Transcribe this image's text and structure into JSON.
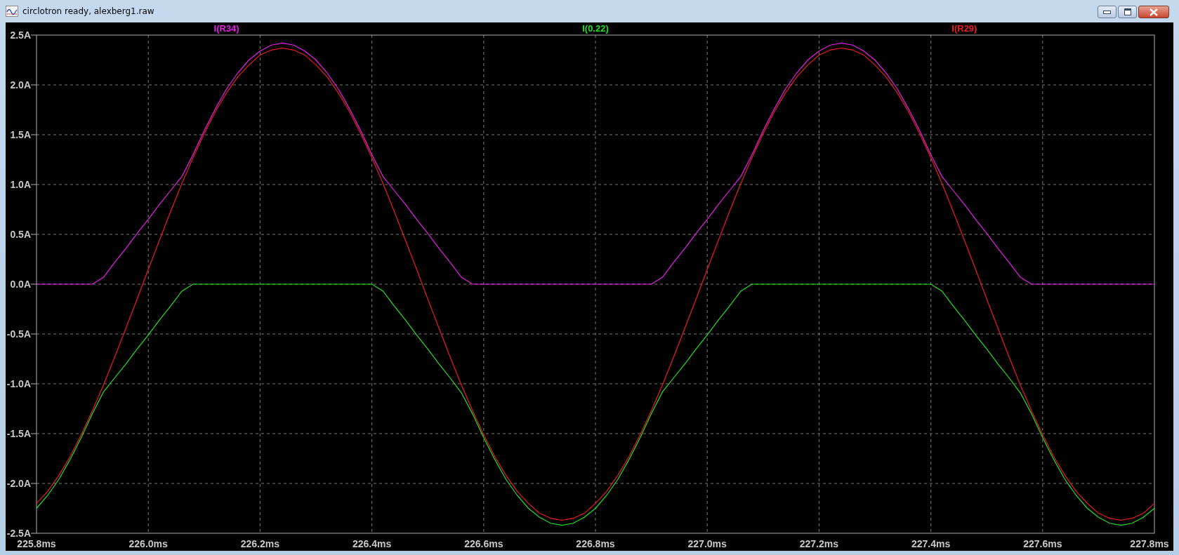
{
  "window": {
    "title": "circlotron ready, alexberg1.raw"
  },
  "plot": {
    "chart_data": {
      "type": "line",
      "x": [
        225.8,
        225.82,
        225.84,
        225.86,
        225.88,
        225.9,
        225.92,
        225.94,
        225.96,
        225.98,
        226,
        226.02,
        226.04,
        226.06,
        226.08,
        226.1,
        226.12,
        226.14,
        226.16,
        226.18,
        226.2,
        226.22,
        226.24,
        226.26,
        226.28,
        226.3,
        226.32,
        226.34,
        226.36,
        226.38,
        226.4,
        226.42,
        226.44,
        226.46,
        226.48,
        226.5,
        226.52,
        226.54,
        226.56,
        226.58,
        226.6,
        226.62,
        226.64,
        226.66,
        226.68,
        226.7,
        226.72,
        226.74,
        226.76,
        226.78,
        226.8,
        226.82,
        226.84,
        226.86,
        226.88,
        226.9,
        226.92,
        226.94,
        226.96,
        226.98,
        227,
        227.02,
        227.04,
        227.06,
        227.08,
        227.1,
        227.12,
        227.14,
        227.16,
        227.18,
        227.2,
        227.22,
        227.24,
        227.26,
        227.28,
        227.3,
        227.32,
        227.34,
        227.36,
        227.38,
        227.4,
        227.42,
        227.44,
        227.46,
        227.48,
        227.5,
        227.52,
        227.54,
        227.56,
        227.58,
        227.6,
        227.62,
        227.64,
        227.66,
        227.68,
        227.7,
        227.72,
        227.74,
        227.76,
        227.78,
        227.8
      ],
      "series": [
        {
          "name": "I(R34)",
          "color": "#e81ee8",
          "values": [
            0,
            0,
            0,
            0,
            0,
            0,
            0.07,
            0.22,
            0.36,
            0.51,
            0.65,
            0.8,
            0.94,
            1.08,
            1.3,
            1.54,
            1.76,
            1.96,
            2.12,
            2.25,
            2.34,
            2.4,
            2.42,
            2.4,
            2.34,
            2.25,
            2.12,
            1.96,
            1.76,
            1.54,
            1.3,
            1.08,
            0.94,
            0.8,
            0.65,
            0.51,
            0.36,
            0.22,
            0.07,
            0,
            0,
            0,
            0,
            0,
            0,
            0,
            0,
            0,
            0,
            0,
            0,
            0,
            0,
            0,
            0,
            0,
            0.07,
            0.22,
            0.36,
            0.51,
            0.65,
            0.8,
            0.94,
            1.08,
            1.3,
            1.54,
            1.76,
            1.96,
            2.12,
            2.25,
            2.34,
            2.4,
            2.42,
            2.4,
            2.34,
            2.25,
            2.12,
            1.96,
            1.76,
            1.54,
            1.3,
            1.08,
            0.94,
            0.8,
            0.65,
            0.51,
            0.36,
            0.22,
            0.07,
            0,
            0,
            0,
            0,
            0,
            0,
            0,
            0,
            0,
            0,
            0,
            0
          ]
        },
        {
          "name": "I(0.22)",
          "color": "#22e022",
          "values": [
            -2.25,
            -2.12,
            -1.96,
            -1.76,
            -1.54,
            -1.3,
            -1.08,
            -0.94,
            -0.8,
            -0.65,
            -0.51,
            -0.36,
            -0.22,
            -0.07,
            0,
            0,
            0,
            0,
            0,
            0,
            0,
            0,
            0,
            0,
            0,
            0,
            0,
            0,
            0,
            0,
            0,
            -0.07,
            -0.22,
            -0.36,
            -0.51,
            -0.65,
            -0.8,
            -0.94,
            -1.09,
            -1.3,
            -1.54,
            -1.76,
            -1.96,
            -2.12,
            -2.25,
            -2.34,
            -2.4,
            -2.42,
            -2.4,
            -2.34,
            -2.25,
            -2.12,
            -1.96,
            -1.76,
            -1.54,
            -1.3,
            -1.08,
            -0.94,
            -0.8,
            -0.65,
            -0.51,
            -0.36,
            -0.22,
            -0.07,
            0,
            0,
            0,
            0,
            0,
            0,
            0,
            0,
            0,
            0,
            0,
            0,
            0,
            0,
            0,
            0,
            0,
            -0.07,
            -0.22,
            -0.36,
            -0.51,
            -0.65,
            -0.8,
            -0.94,
            -1.09,
            -1.3,
            -1.54,
            -1.76,
            -1.96,
            -2.12,
            -2.25,
            -2.34,
            -2.4,
            -2.42,
            -2.4,
            -2.34,
            -2.25
          ]
        },
        {
          "name": "I(R29)",
          "color": "#ee1c1c",
          "values": [
            -2.2,
            -2.08,
            -1.92,
            -1.73,
            -1.51,
            -1.27,
            -1.01,
            -0.73,
            -0.44,
            -0.15,
            0.15,
            0.44,
            0.73,
            1.01,
            1.27,
            1.51,
            1.73,
            1.92,
            2.08,
            2.2,
            2.3,
            2.35,
            2.37,
            2.35,
            2.3,
            2.2,
            2.08,
            1.92,
            1.73,
            1.51,
            1.27,
            1.01,
            0.73,
            0.44,
            0.15,
            -0.15,
            -0.44,
            -0.73,
            -1.01,
            -1.27,
            -1.51,
            -1.73,
            -1.92,
            -2.08,
            -2.2,
            -2.3,
            -2.35,
            -2.37,
            -2.35,
            -2.3,
            -2.2,
            -2.08,
            -1.92,
            -1.73,
            -1.51,
            -1.27,
            -1.01,
            -0.73,
            -0.44,
            -0.15,
            0.15,
            0.44,
            0.73,
            1.01,
            1.27,
            1.51,
            1.73,
            1.92,
            2.08,
            2.2,
            2.3,
            2.35,
            2.37,
            2.35,
            2.3,
            2.2,
            2.08,
            1.92,
            1.73,
            1.51,
            1.27,
            1.01,
            0.73,
            0.44,
            0.15,
            -0.15,
            -0.44,
            -0.73,
            -1.01,
            -1.27,
            -1.51,
            -1.73,
            -1.92,
            -2.08,
            -2.2,
            -2.3,
            -2.35,
            -2.37,
            -2.35,
            -2.3,
            -2.2
          ]
        }
      ],
      "grid": true,
      "xlim": [
        225.8,
        227.8
      ],
      "ylim": [
        -2.5,
        2.5
      ],
      "xticks": [
        {
          "value": 225.8,
          "label": "225.8ms"
        },
        {
          "value": 226.0,
          "label": "226.0ms"
        },
        {
          "value": 226.2,
          "label": "226.2ms"
        },
        {
          "value": 226.4,
          "label": "226.4ms"
        },
        {
          "value": 226.6,
          "label": "226.6ms"
        },
        {
          "value": 226.8,
          "label": "226.8ms"
        },
        {
          "value": 227.0,
          "label": "227.0ms"
        },
        {
          "value": 227.2,
          "label": "227.2ms"
        },
        {
          "value": 227.4,
          "label": "227.4ms"
        },
        {
          "value": 227.6,
          "label": "227.6ms"
        },
        {
          "value": 227.8,
          "label": "227.8ms"
        }
      ],
      "yticks": [
        {
          "value": 2.5,
          "label": "2.5A"
        },
        {
          "value": 2.0,
          "label": "2.0A"
        },
        {
          "value": 1.5,
          "label": "1.5A"
        },
        {
          "value": 1.0,
          "label": "1.0A"
        },
        {
          "value": 0.5,
          "label": "0.5A"
        },
        {
          "value": 0,
          "label": "0.0A"
        },
        {
          "value": -0.5,
          "label": "-0.5A"
        },
        {
          "value": -1.0,
          "label": "-1.0A"
        },
        {
          "value": -1.5,
          "label": "-1.5A"
        },
        {
          "value": -2.0,
          "label": "-2.0A"
        },
        {
          "value": -2.5,
          "label": "-2.5A"
        }
      ]
    }
  }
}
